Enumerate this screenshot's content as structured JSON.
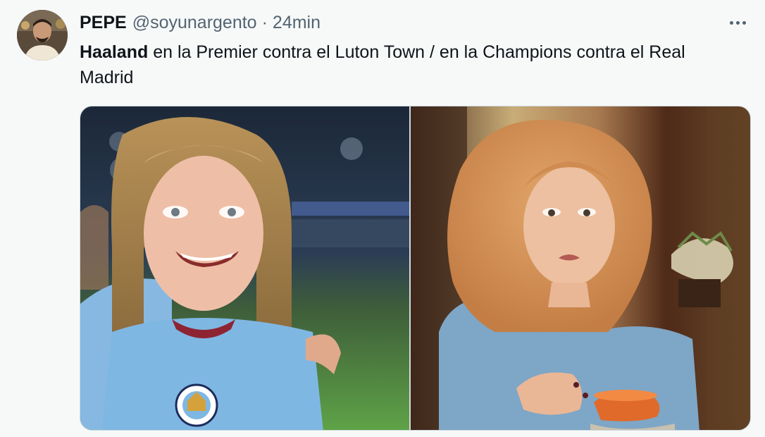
{
  "author": {
    "display_name": "PEPE",
    "handle": "@soyunargento",
    "separator": "·",
    "time": "24min"
  },
  "tweet": {
    "bold_word": "Haaland",
    "text_rest": " en la Premier contra el Luton Town / en la Champions contra el Real Madrid"
  },
  "icons": {
    "more": "more-options-icon"
  },
  "media": {
    "left_image": "footballer-laughing-photo",
    "right_image": "woman-blonde-wig-holding-teacup-photo"
  },
  "colors": {
    "background": "#f7f9f9",
    "text_primary": "#0f1419",
    "text_secondary": "#536471",
    "border": "#cfd9de"
  }
}
